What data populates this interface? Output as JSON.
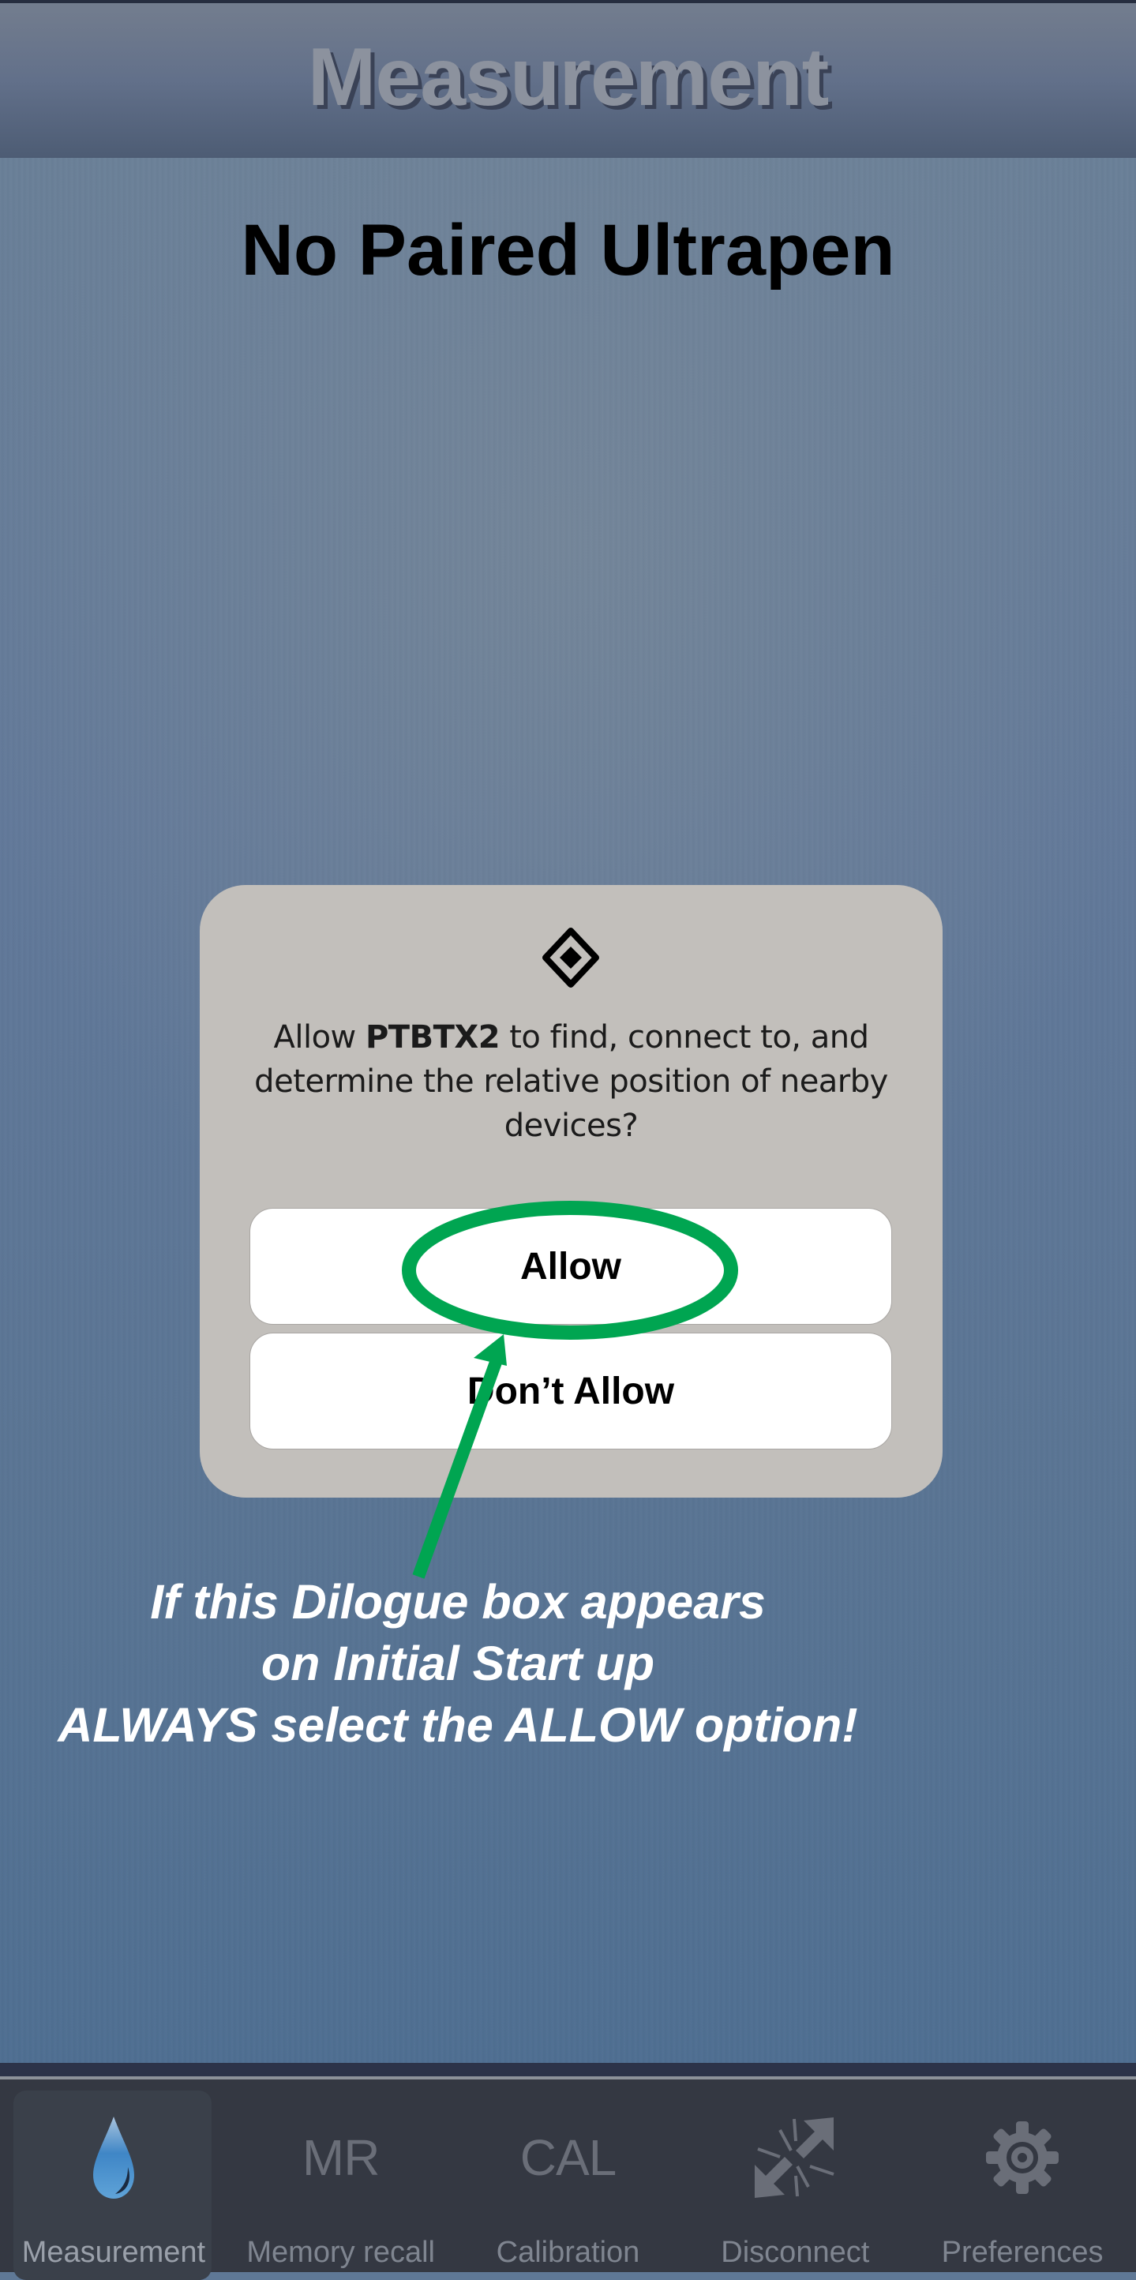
{
  "header": {
    "title": "Measurement"
  },
  "main": {
    "status_title": "No Paired Ultrapen"
  },
  "dialog": {
    "icon": "nearby-devices-icon",
    "message_prefix": "Allow ",
    "app_name": "PTBTX2",
    "message_suffix": " to find, connect to, and determine the relative position of nearby devices?",
    "allow_label": "Allow",
    "deny_label": "Don’t Allow"
  },
  "annotation": {
    "color": "#00A551",
    "lines": [
      "If this Dilogue box appears",
      "on Initial Start up",
      "ALWAYS select the ALLOW option!"
    ]
  },
  "nav": {
    "items": [
      {
        "label": "Measurement",
        "icon": "water-drop-icon",
        "icon_text": "",
        "selected": true
      },
      {
        "label": "Memory recall",
        "icon": "memory-recall-icon",
        "icon_text": "MR",
        "selected": false
      },
      {
        "label": "Calibration",
        "icon": "calibration-icon",
        "icon_text": "CAL",
        "selected": false
      },
      {
        "label": "Disconnect",
        "icon": "disconnect-icon",
        "icon_text": "",
        "selected": false
      },
      {
        "label": "Preferences",
        "icon": "gear-icon",
        "icon_text": "",
        "selected": false
      }
    ]
  },
  "colors": {
    "dialog_bg": "#C2BFBB",
    "annotation_green": "#00A551",
    "navbar_bg": "#343842",
    "icon_gray": "#6A6E78"
  }
}
